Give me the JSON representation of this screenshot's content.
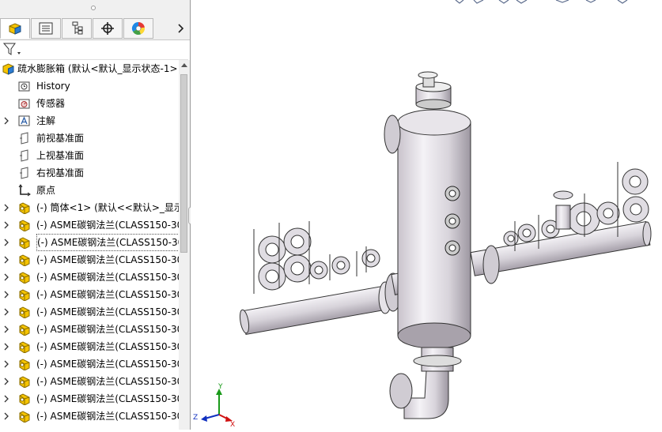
{
  "feature_tree": {
    "root": {
      "label": "疏水膨胀箱 (默认<默认_显示状态-1>"
    },
    "items": [
      {
        "label": "History",
        "icon": "history-folder-icon"
      },
      {
        "label": "传感器",
        "icon": "sensor-icon"
      },
      {
        "label": "注解",
        "icon": "annotation-icon",
        "expandable": true
      },
      {
        "label": "前视基准面",
        "icon": "plane-icon"
      },
      {
        "label": "上视基准面",
        "icon": "plane-icon"
      },
      {
        "label": "右视基准面",
        "icon": "plane-icon"
      },
      {
        "label": "原点",
        "icon": "origin-icon"
      },
      {
        "label": "(-) 筒体<1> (默认<<默认>_显示",
        "icon": "part-icon",
        "expandable": true
      },
      {
        "label": "(-) ASME碳钢法兰(CLASS150-30",
        "icon": "part-icon",
        "expandable": true
      },
      {
        "label": "(-) ASME碳钢法兰(CLASS150-30",
        "icon": "part-icon",
        "expandable": true,
        "selected": true
      },
      {
        "label": "(-) ASME碳钢法兰(CLASS150-30",
        "icon": "part-icon",
        "expandable": true
      },
      {
        "label": "(-) ASME碳钢法兰(CLASS150-30",
        "icon": "part-icon",
        "expandable": true
      },
      {
        "label": "(-) ASME碳钢法兰(CLASS150-30",
        "icon": "part-icon",
        "expandable": true
      },
      {
        "label": "(-) ASME碳钢法兰(CLASS150-30",
        "icon": "part-icon",
        "expandable": true
      },
      {
        "label": "(-) ASME碳钢法兰(CLASS150-30",
        "icon": "part-icon",
        "expandable": true
      },
      {
        "label": "(-) ASME碳钢法兰(CLASS150-30",
        "icon": "part-icon",
        "expandable": true
      },
      {
        "label": "(-) ASME碳钢法兰(CLASS150-30",
        "icon": "part-icon",
        "expandable": true
      },
      {
        "label": "(-) ASME碳钢法兰(CLASS150-30",
        "icon": "part-icon",
        "expandable": true
      },
      {
        "label": "(-) ASME碳钢法兰(CLASS150-30",
        "icon": "part-icon",
        "expandable": true
      },
      {
        "label": "(-) ASME碳钢法兰(CLASS150-30",
        "icon": "part-icon",
        "expandable": true
      }
    ]
  },
  "tabs": [
    {
      "name": "featuremanager-tab",
      "icon": "assembly-icon",
      "active": true
    },
    {
      "name": "propertymanager-tab",
      "icon": "property-list-icon"
    },
    {
      "name": "configurationmanager-tab",
      "icon": "configuration-icon"
    },
    {
      "name": "dimxpert-tab",
      "icon": "crosshair-icon"
    },
    {
      "name": "display-manager-tab",
      "icon": "color-wheel-icon"
    }
  ],
  "triad": {
    "x": "X",
    "y": "Y",
    "z": "Z"
  },
  "colors": {
    "accent": "#f5c400",
    "selection": "#555555",
    "axis_x": "#d01010",
    "axis_y": "#1a9a1a",
    "axis_z": "#1030c0"
  }
}
